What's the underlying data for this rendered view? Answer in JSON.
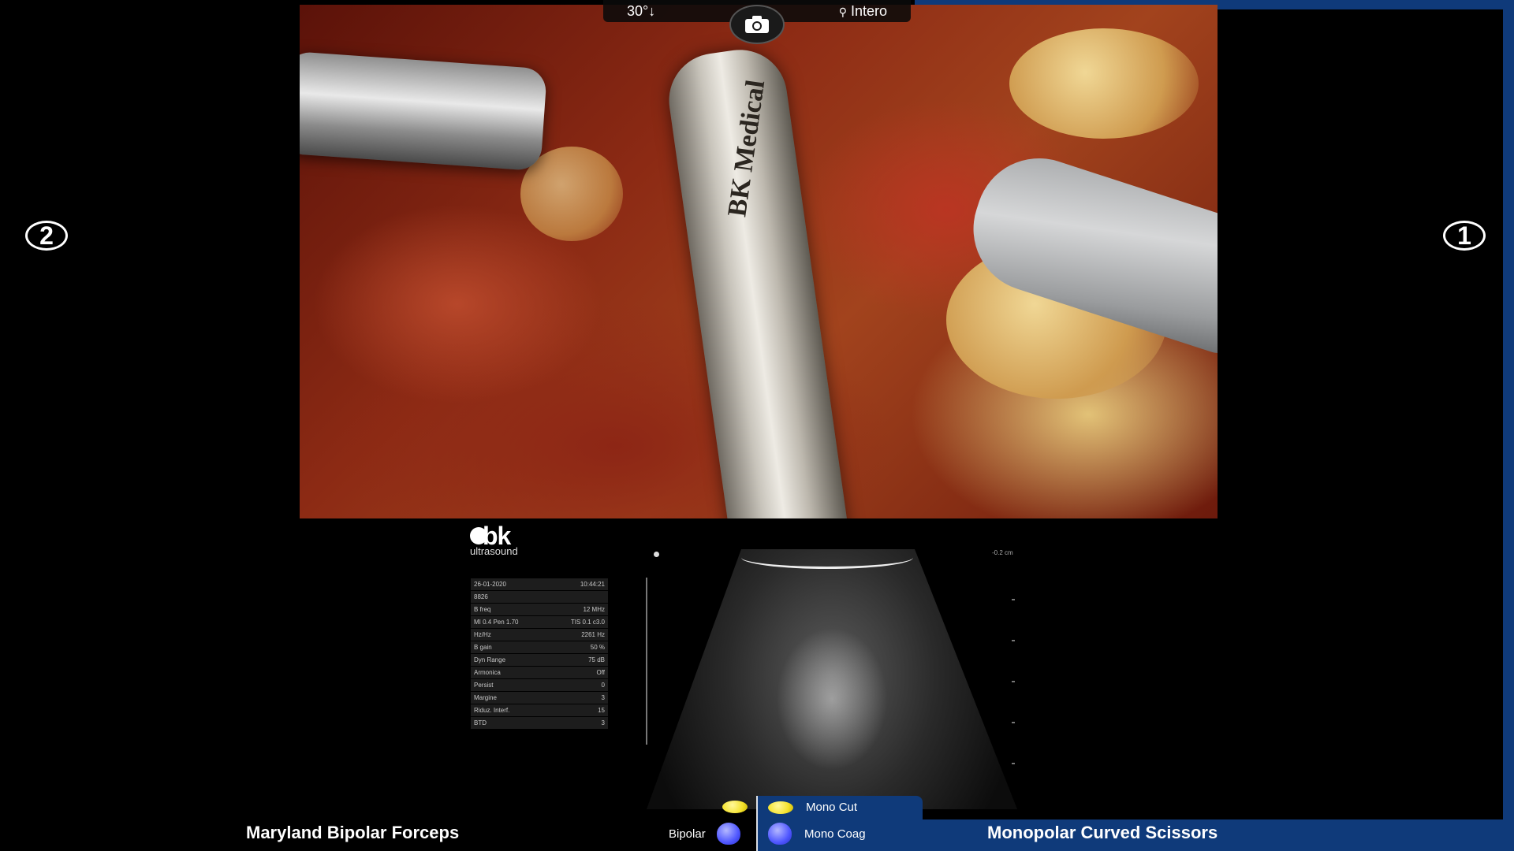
{
  "top_bar": {
    "angle": "30°↓",
    "mode": "Intero"
  },
  "arms": {
    "left": "2",
    "right": "1"
  },
  "endoscope": {
    "probe_brand": "BK Medical"
  },
  "ultrasound": {
    "logo_top": "bk",
    "logo_bottom": "ultrasound",
    "depth_label": "-0.2 cm",
    "params": [
      {
        "label": "26-01-2020",
        "value": "10:44:21"
      },
      {
        "label": "8826",
        "value": ""
      },
      {
        "label": "B freq",
        "value": "12 MHz"
      },
      {
        "label": "MI 0.4 Pen 1.70",
        "value": "TIS 0.1 c3.0"
      },
      {
        "label": "Hz/Hz",
        "value": "2261 Hz"
      },
      {
        "label": "B gain",
        "value": "50 %"
      },
      {
        "label": "Dyn Range",
        "value": "75 dB"
      },
      {
        "label": "Armonica",
        "value": "Off"
      },
      {
        "label": "Persist",
        "value": "0"
      },
      {
        "label": "Margine",
        "value": "3"
      },
      {
        "label": "Riduz. Interf.",
        "value": "15"
      },
      {
        "label": "BTD",
        "value": "3"
      }
    ]
  },
  "energy": {
    "left_pedal_label": "Bipolar",
    "right_pedal_top": "Mono Cut",
    "right_pedal_bottom": "Mono Coag"
  },
  "instruments": {
    "left": "Maryland Bipolar Forceps",
    "right": "Monopolar Curved Scissors"
  },
  "colors": {
    "console_blue": "#0f3a7a",
    "pedal_yellow": "#f4e22b",
    "pedal_blue": "#4f57ff"
  }
}
